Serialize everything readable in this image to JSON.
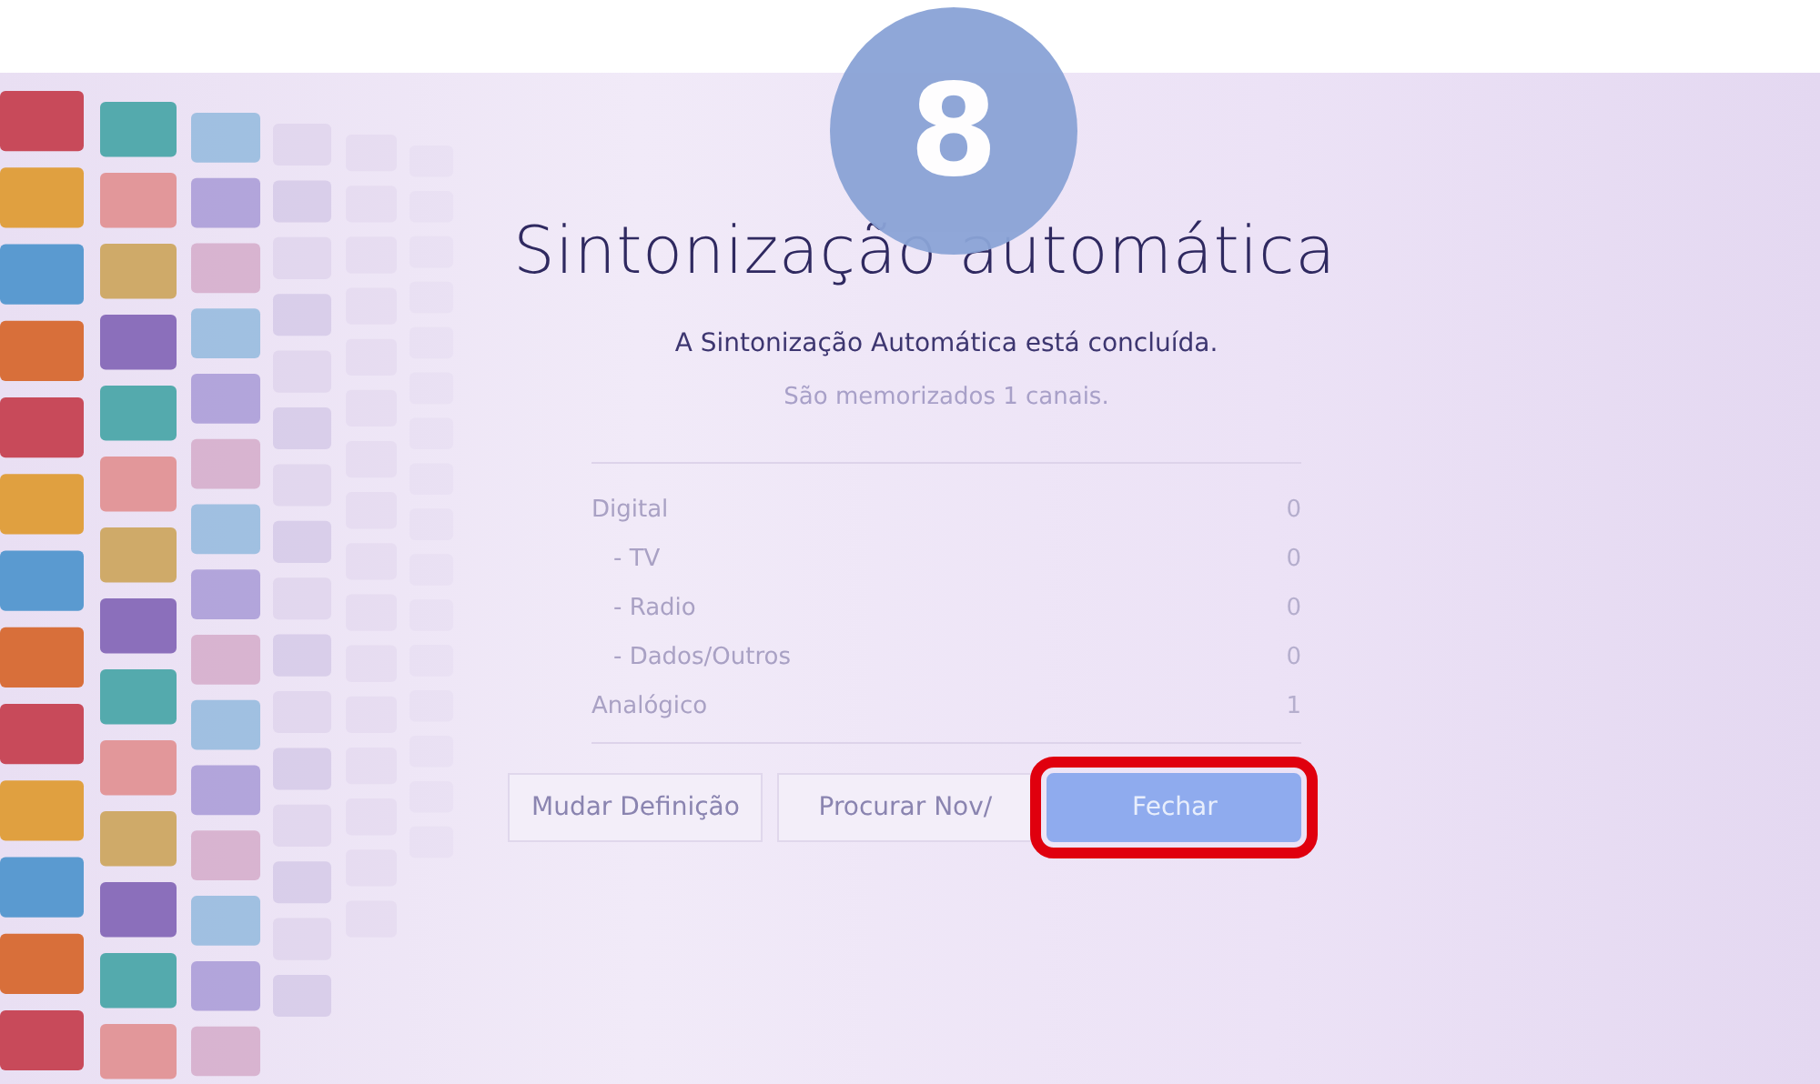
{
  "step_badge": "8",
  "title": "Sintonização automática",
  "message": "A Sintonização Automática está concluída.",
  "summary": "São memorizados 1  canais.",
  "results": [
    {
      "label": "Digital",
      "value": "0",
      "children": [
        {
          "label": "- TV",
          "value": "0"
        },
        {
          "label": "- Radio",
          "value": "0"
        },
        {
          "label": "- Dados/Outros",
          "value": "0"
        }
      ]
    },
    {
      "label": "Analógico",
      "value": "1"
    }
  ],
  "buttons": [
    {
      "label": "Mudar Definição",
      "selected": false,
      "highlighted": false
    },
    {
      "label": "Procurar Nov/",
      "selected": false,
      "highlighted": false
    },
    {
      "label": "Fechar",
      "selected": true,
      "highlighted": true
    }
  ]
}
